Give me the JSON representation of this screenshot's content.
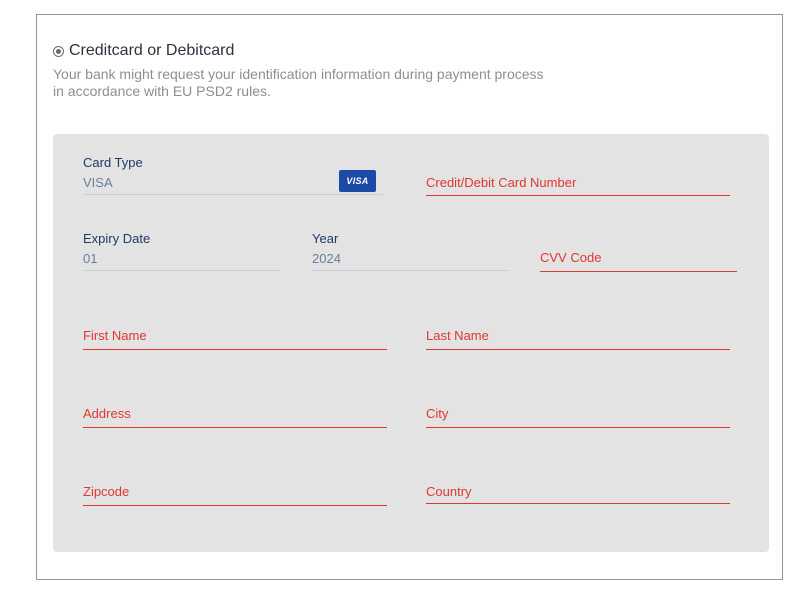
{
  "payment_method": {
    "label": "Creditcard or Debitcard",
    "selected": true
  },
  "notice": {
    "line1": "Your bank might request your identification information during payment process",
    "line2": "in accordance with EU PSD2 rules."
  },
  "card_type": {
    "label": "Card Type",
    "value": "VISA",
    "badge": "VISA"
  },
  "card_number": {
    "placeholder": "Credit/Debit Card Number"
  },
  "expiry_date": {
    "label": "Expiry Date",
    "value": "01"
  },
  "year": {
    "label": "Year",
    "value": "2024"
  },
  "cvv": {
    "placeholder": "CVV Code"
  },
  "first_name": {
    "placeholder": "First Name"
  },
  "last_name": {
    "placeholder": "Last Name"
  },
  "address": {
    "placeholder": "Address"
  },
  "city": {
    "placeholder": "City"
  },
  "zipcode": {
    "placeholder": "Zipcode"
  },
  "country": {
    "placeholder": "Country"
  },
  "colors": {
    "panel_bg": "#e3e3e3",
    "required_red": "#e0372e",
    "label_blue": "#1f3a68",
    "visa_blue": "#1c4aa8"
  }
}
